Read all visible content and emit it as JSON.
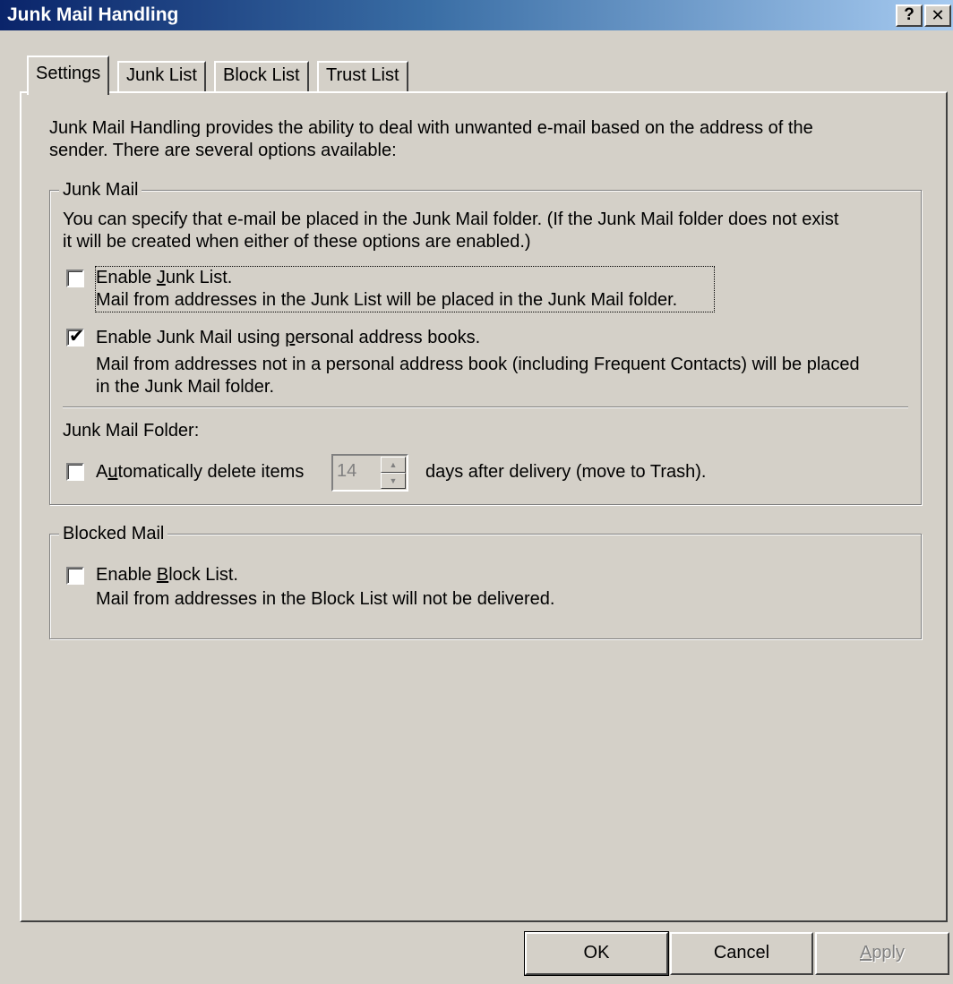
{
  "window": {
    "title": "Junk Mail Handling",
    "help_button": "?",
    "close_button": "✕"
  },
  "tabs": [
    {
      "label": "Settings",
      "active": true
    },
    {
      "label": "Junk List",
      "active": false
    },
    {
      "label": "Block List",
      "active": false
    },
    {
      "label": "Trust List",
      "active": false
    }
  ],
  "intro": {
    "line1": "Junk Mail Handling provides the ability to deal with unwanted e-mail based on the address of the",
    "line2": "sender.  There are several options available:"
  },
  "junk_mail_group": {
    "label": "Junk Mail",
    "desc_line1": "You can specify that e-mail be placed in the Junk Mail folder.  (If the Junk Mail folder does not exist",
    "desc_line2": "it will be created when either of these options are enabled.)",
    "enable_junk_list": {
      "label_pre": "Enable ",
      "label_accel": "J",
      "label_post": "unk List.",
      "desc": "Mail from addresses in the Junk List will be placed in the Junk Mail folder.",
      "checked": false
    },
    "enable_pab": {
      "label_pre": "Enable Junk Mail using ",
      "label_accel": "p",
      "label_post": "ersonal address books.",
      "desc_line1": "Mail from addresses not in a personal address book (including Frequent Contacts) will be placed",
      "desc_line2": "in the Junk Mail folder.",
      "checked": true,
      "check_glyph": "✔"
    },
    "folder_label": "Junk Mail Folder:",
    "auto_delete": {
      "label_pre": "A",
      "label_accel": "u",
      "label_post": "tomatically delete items",
      "days_value": "14",
      "suffix": "days after delivery (move to Trash).",
      "checked": false
    }
  },
  "blocked_mail_group": {
    "label": "Blocked Mail",
    "enable_block_list": {
      "label_pre": "Enable ",
      "label_accel": "B",
      "label_post": "lock List.",
      "desc": "Mail from addresses in the Block List will not be delivered.",
      "checked": false
    }
  },
  "buttons": {
    "ok": "OK",
    "cancel": "Cancel",
    "apply_accel": "A",
    "apply_rest": "pply"
  }
}
